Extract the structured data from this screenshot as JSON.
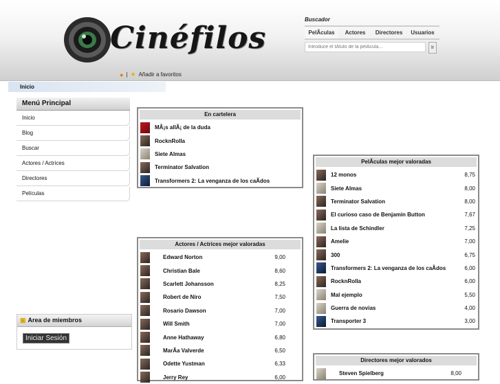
{
  "header": {
    "logo_text": "Cinéfilos",
    "favorites_label": "Añadir a favoritos",
    "separator": "|"
  },
  "search": {
    "title": "Buscador",
    "tabs": [
      "PelÃculas",
      "Actores",
      "Directores",
      "Usuarios"
    ],
    "placeholder": "Introduce el tÃtulo de la pelÃcula...",
    "button_label": "Ir"
  },
  "breadcrumb": {
    "label": "Inicio"
  },
  "menu": {
    "title": "Menú Principal",
    "items": [
      "Inicio",
      "Blog",
      "Buscar",
      "Actores / Actrices",
      "Directores",
      "Películas"
    ]
  },
  "members": {
    "title": "Area de miembros",
    "login_label": "Iniciar Sesión"
  },
  "cartelera": {
    "title": "En cartelera",
    "items": [
      "MÃ¡s allÃ¡ de la duda",
      "RocknRolla",
      "Siete Almas",
      "Terminator Salvation",
      "Transformers 2: La venganza de los caÃdos"
    ]
  },
  "actors": {
    "title": "Actores / Actrices mejor valoradas",
    "rows": [
      {
        "name": "Edward Norton",
        "score": "9,00"
      },
      {
        "name": "Christian Bale",
        "score": "8,60"
      },
      {
        "name": "Scarlett Johansson",
        "score": "8,25"
      },
      {
        "name": "Robert de Niro",
        "score": "7,50"
      },
      {
        "name": "Rosario Dawson",
        "score": "7,00"
      },
      {
        "name": "Will Smith",
        "score": "7,00"
      },
      {
        "name": "Anne Hathaway",
        "score": "6,80"
      },
      {
        "name": "MarÃa Valverde",
        "score": "6,50"
      },
      {
        "name": "Odette Yustman",
        "score": "6,33"
      },
      {
        "name": "Jerry Rey",
        "score": "6,00"
      }
    ]
  },
  "movies": {
    "title": "PelÃculas mejor valoradas",
    "rows": [
      {
        "name": "12 monos",
        "score": "8,75"
      },
      {
        "name": "Siete Almas",
        "score": "8,00"
      },
      {
        "name": "Terminator Salvation",
        "score": "8,00"
      },
      {
        "name": "El curioso caso de Benjamin Button",
        "score": "7,67"
      },
      {
        "name": "La lista de Schindler",
        "score": "7,25"
      },
      {
        "name": "Amelie",
        "score": "7,00"
      },
      {
        "name": "300",
        "score": "6,75"
      },
      {
        "name": "Transformers 2: La venganza de los caÃdos",
        "score": "6,00"
      },
      {
        "name": "RocknRolla",
        "score": "6,00"
      },
      {
        "name": "Mal ejemplo",
        "score": "5,50"
      },
      {
        "name": "Guerra de novias",
        "score": "4,00"
      },
      {
        "name": "Transporter 3",
        "score": "3,00"
      }
    ]
  },
  "directors": {
    "title": "Directores mejor valorados",
    "rows": [
      {
        "name": "Steven Spielberg",
        "score": "8,00"
      }
    ]
  }
}
